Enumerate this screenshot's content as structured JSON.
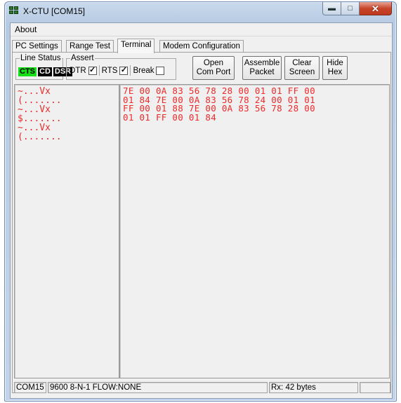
{
  "window": {
    "title": "X-CTU  [COM15]"
  },
  "menu": {
    "items": [
      "About"
    ]
  },
  "tabs": [
    {
      "label": "PC Settings",
      "active": false
    },
    {
      "label": "Range Test",
      "active": false
    },
    {
      "label": "Terminal",
      "active": true
    },
    {
      "label": "Modem Configuration",
      "active": false
    }
  ],
  "line_status": {
    "label": "Line Status",
    "indicators": [
      "CTS",
      "CD",
      "DSR"
    ],
    "cts_color": "#18e018"
  },
  "assert": {
    "label": "Assert",
    "dtr": {
      "label": "DTR",
      "checked": true
    },
    "rts": {
      "label": "RTS",
      "checked": true
    },
    "break": {
      "label": "Break",
      "checked": false
    }
  },
  "buttons": {
    "open_com_port": [
      "Open",
      "Com Port"
    ],
    "assemble_packet": [
      "Assemble",
      "Packet"
    ],
    "clear_screen": [
      "Clear",
      "Screen"
    ],
    "hide_hex": [
      "Hide",
      "Hex"
    ]
  },
  "terminal": {
    "text_color": "#ee2a2a",
    "ascii_lines": [
      "~...Vx",
      "(.......",
      "~...Vx",
      "$.......",
      "~...Vx",
      "(......."
    ],
    "hex_lines": [
      "7E 00 0A 83 56 78 28 00 01 01 FF 00",
      "01 84 7E 00 0A 83 56 78 24 00 01 01",
      "FF 00 01 88 7E 00 0A 83 56 78 28 00",
      "01 01 FF 00 01 84"
    ]
  },
  "status": {
    "port": "COM15",
    "settings": "9600 8-N-1  FLOW:NONE",
    "rx": "Rx: 42 bytes"
  }
}
